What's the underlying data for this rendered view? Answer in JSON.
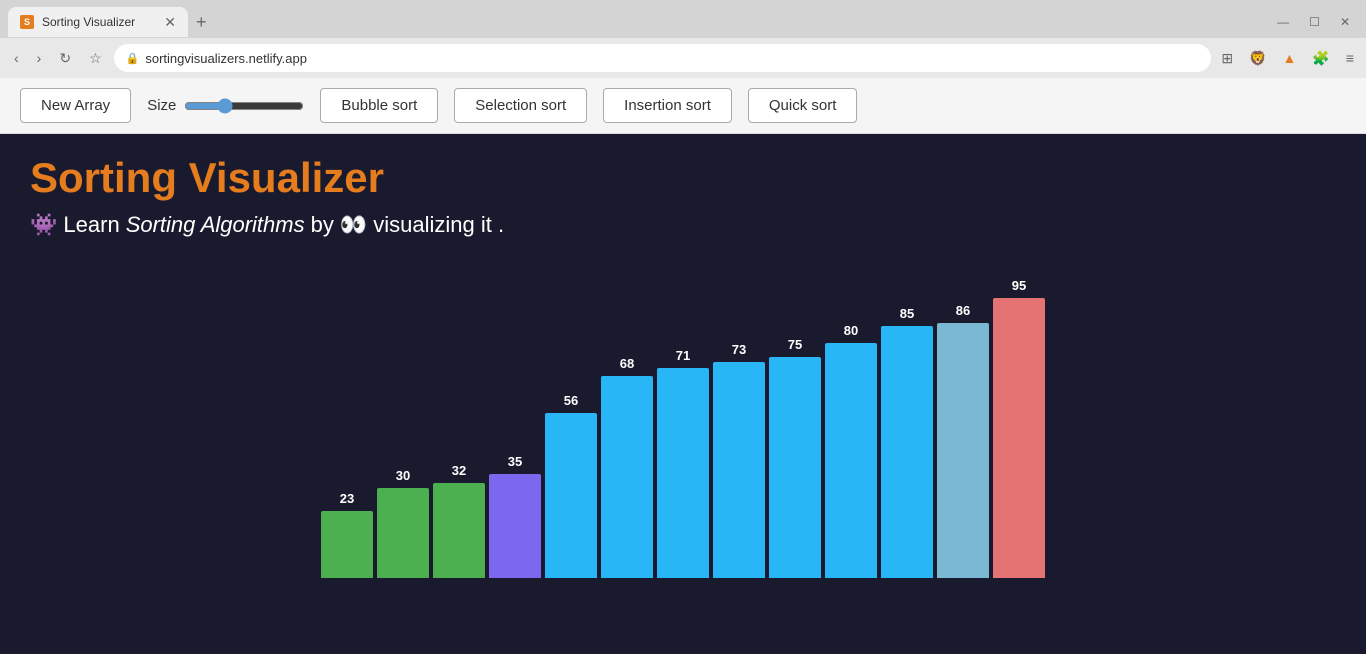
{
  "browser": {
    "tab_title": "Sorting Visualizer",
    "tab_favicon": "S",
    "address": "sortingvisualizers.netlify.app",
    "nav": {
      "back": "‹",
      "forward": "›",
      "refresh": "↻",
      "bookmark": "☆"
    },
    "window_controls": {
      "minimize": "—",
      "maximize": "☐",
      "close": "✕"
    }
  },
  "toolbar": {
    "new_array_label": "New Array",
    "size_label": "Size",
    "bubble_sort_label": "Bubble sort",
    "selection_sort_label": "Selection sort",
    "insertion_sort_label": "Insertion sort",
    "quick_sort_label": "Quick sort",
    "slider_value": 35
  },
  "app": {
    "title": "Sorting Visualizer",
    "subtitle_pre": "Learn",
    "subtitle_em": "Sorting Algorithms",
    "subtitle_mid": "by",
    "subtitle_post": "visualizing it .",
    "emoji1": "👾",
    "emoji2": "👀"
  },
  "bars": [
    {
      "value": 23,
      "color": "#4caf50",
      "height_pct": 24
    },
    {
      "value": 30,
      "color": "#4caf50",
      "height_pct": 32
    },
    {
      "value": 32,
      "color": "#4caf50",
      "height_pct": 34
    },
    {
      "value": 35,
      "color": "#7b68ee",
      "height_pct": 37
    },
    {
      "value": 56,
      "color": "#29b6f6",
      "height_pct": 59
    },
    {
      "value": 68,
      "color": "#29b6f6",
      "height_pct": 72
    },
    {
      "value": 71,
      "color": "#29b6f6",
      "height_pct": 75
    },
    {
      "value": 73,
      "color": "#29b6f6",
      "height_pct": 77
    },
    {
      "value": 75,
      "color": "#29b6f6",
      "height_pct": 79
    },
    {
      "value": 80,
      "color": "#29b6f6",
      "height_pct": 84
    },
    {
      "value": 85,
      "color": "#29b6f6",
      "height_pct": 90
    },
    {
      "value": 86,
      "color": "#7bb8d4",
      "height_pct": 91
    },
    {
      "value": 95,
      "color": "#e57373",
      "height_pct": 100
    }
  ]
}
